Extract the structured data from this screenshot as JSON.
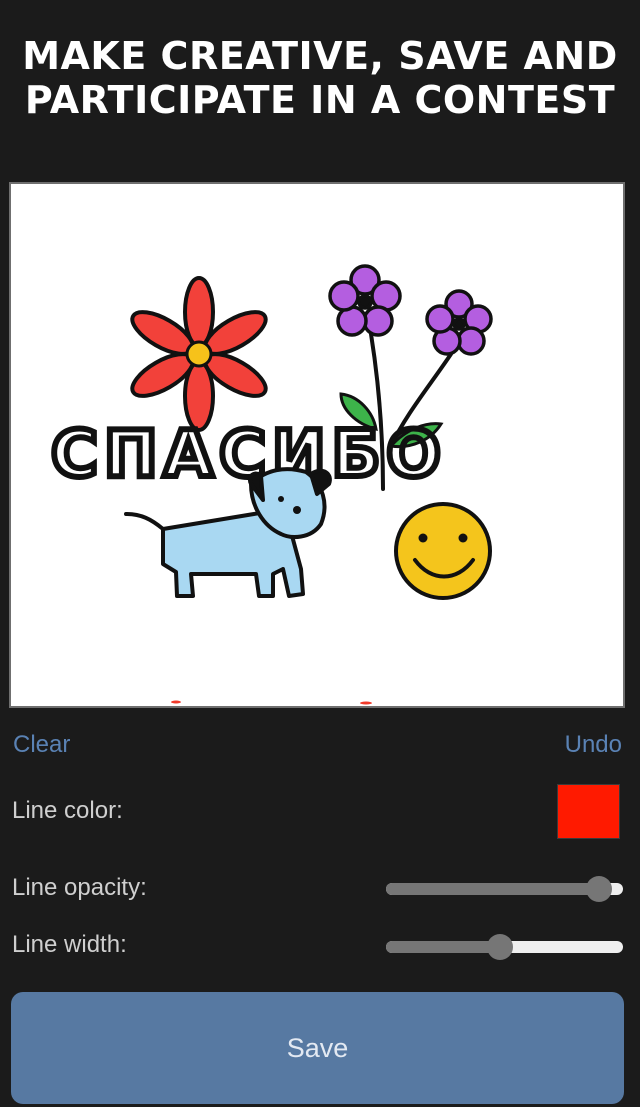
{
  "header": {
    "title_line1": "MAKE CREATIVE, SAVE AND",
    "title_line2": "PARTICIPATE IN A CONTEST"
  },
  "canvas": {
    "drawing_text": "СПАСИБО"
  },
  "controls": {
    "clear_label": "Clear",
    "undo_label": "Undo",
    "line_color_label": "Line color:",
    "line_color_value": "#ff1a00",
    "line_opacity_label": "Line opacity:",
    "line_opacity_value": 0.95,
    "line_width_label": "Line width:",
    "line_width_value": 0.48,
    "save_label": "Save"
  },
  "colors": {
    "background": "#1b1b1b",
    "link": "#5a82b4",
    "button": "#5779a2",
    "slider_fill": "#767676",
    "slider_track": "#efefef"
  }
}
